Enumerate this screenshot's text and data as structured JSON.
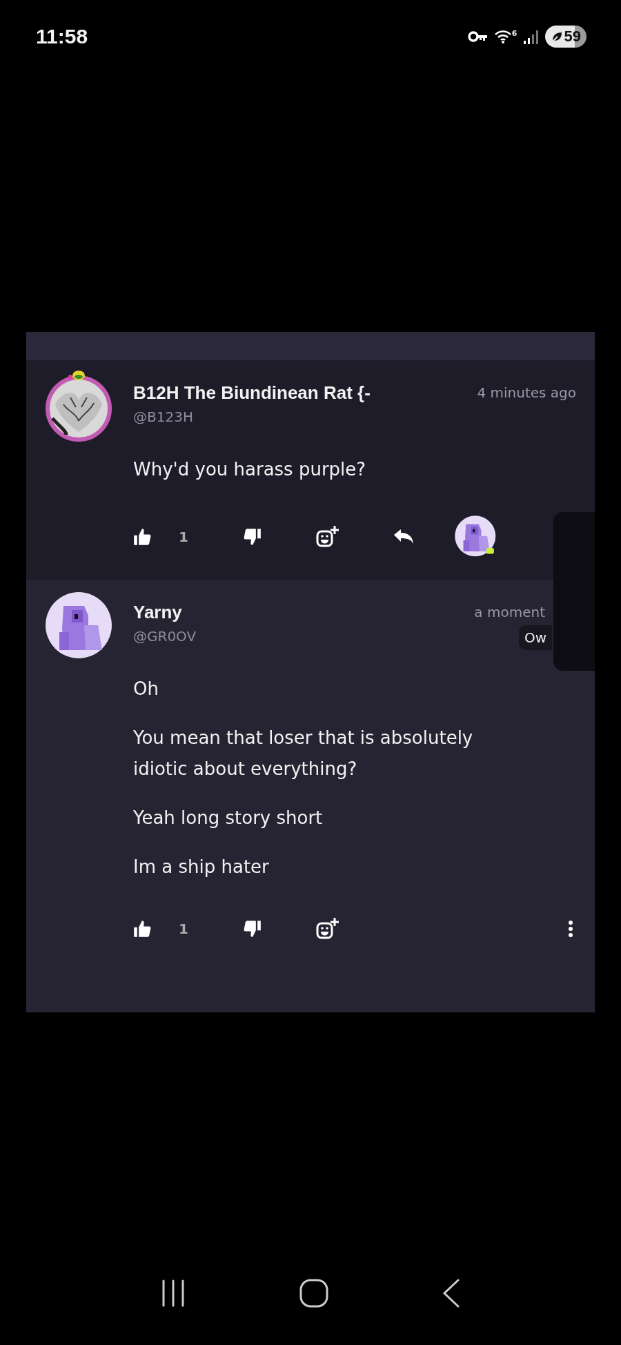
{
  "status_bar": {
    "time": "11:58",
    "battery": "59",
    "wifi_badge": "6"
  },
  "comments": [
    {
      "author": "B12H The Biundinean Rat {-",
      "handle": "@B123H",
      "time": "4 minutes ago",
      "paragraphs": [
        "Why'd you harass purple?"
      ],
      "actions": [
        {
          "kind": "like",
          "count": "1"
        },
        {
          "kind": "dislike"
        },
        {
          "kind": "react"
        },
        {
          "kind": "reply"
        },
        {
          "kind": "replier"
        }
      ]
    },
    {
      "author": "Yarny",
      "handle": "@GR0OV",
      "time": "a moment",
      "badge": "Ow",
      "paragraphs": [
        "Oh",
        "You mean that loser that is absolutely idiotic about everything?",
        "Yeah long story short",
        "Im a ship hater"
      ],
      "actions": [
        {
          "kind": "like",
          "count": "1"
        },
        {
          "kind": "dislike"
        },
        {
          "kind": "react"
        },
        {
          "kind": "more"
        }
      ]
    }
  ]
}
